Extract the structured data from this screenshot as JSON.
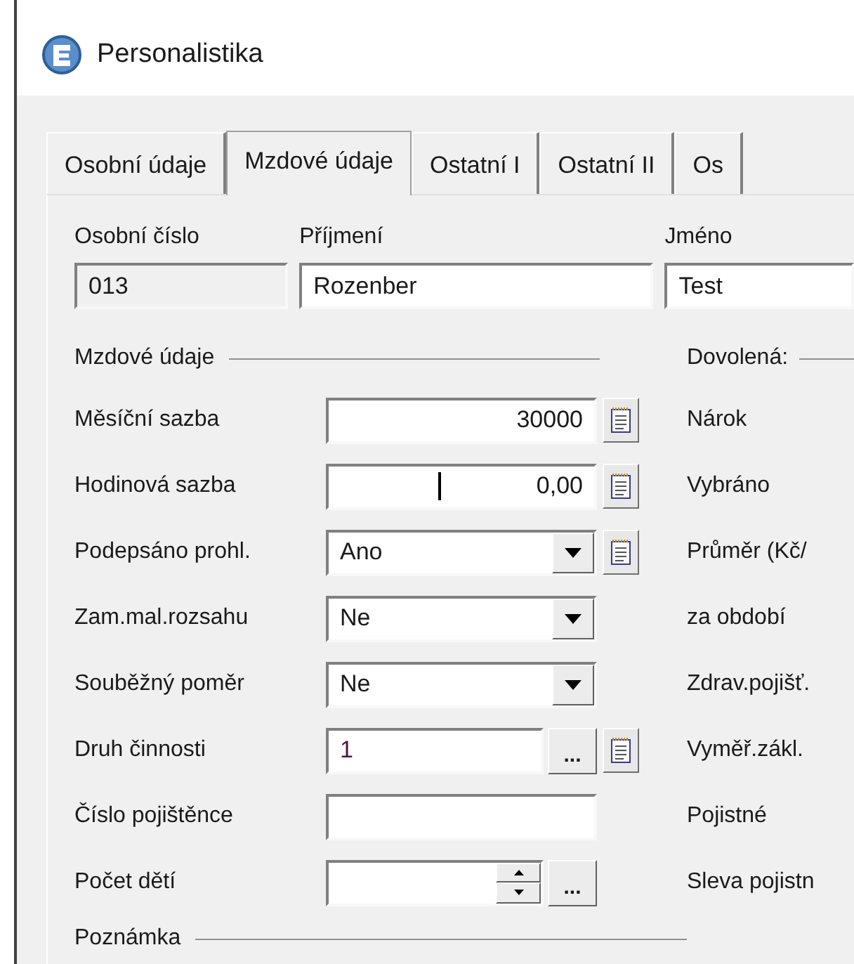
{
  "window": {
    "title": "Personalistika"
  },
  "tabs": [
    {
      "label": "Osobní údaje",
      "selected": false
    },
    {
      "label": "Mzdové údaje",
      "selected": true
    },
    {
      "label": "Ostatní I",
      "selected": false
    },
    {
      "label": "Ostatní II",
      "selected": false
    },
    {
      "label": "Os",
      "selected": false
    }
  ],
  "header_fields": [
    {
      "label": "Osobní číslo",
      "value": "013",
      "disabled": true
    },
    {
      "label": "Příjmení",
      "value": "Rozenber",
      "disabled": false
    },
    {
      "label": "Jméno",
      "value": "Test",
      "disabled": false
    }
  ],
  "wage_section": {
    "title": "Mzdové údaje",
    "rows": [
      {
        "label": "Měsíční sazba",
        "kind": "number",
        "value": "30000",
        "note_button": true
      },
      {
        "label": "Hodinová sazba",
        "kind": "number",
        "value": "0,00",
        "note_button": true,
        "focused": true
      },
      {
        "label": "Podepsáno prohl.",
        "kind": "combo",
        "value": "Ano",
        "note_button": true
      },
      {
        "label": "Zam.mal.rozsahu",
        "kind": "combo",
        "value": "Ne",
        "note_button": false
      },
      {
        "label": "Souběžný poměr",
        "kind": "combo",
        "value": "Ne",
        "note_button": false
      },
      {
        "label": "Druh činnosti",
        "kind": "lookup",
        "value": "1",
        "ellipsis": "...",
        "note_button": true
      },
      {
        "label": "Číslo pojištěnce",
        "kind": "text",
        "note_button": false
      },
      {
        "label": "Počet dětí",
        "kind": "spinner",
        "ellipsis": "...",
        "note_button": false
      }
    ]
  },
  "vacation_section": {
    "title": "Dovolená:",
    "labels": [
      "Nárok",
      "Vybráno",
      "Průměr (Kč/",
      "za období",
      "Zdrav.pojišť.",
      "Vyměř.zákl.",
      "Pojistné",
      "Sleva pojistn"
    ]
  },
  "note_section": {
    "title": "Poznámka"
  }
}
